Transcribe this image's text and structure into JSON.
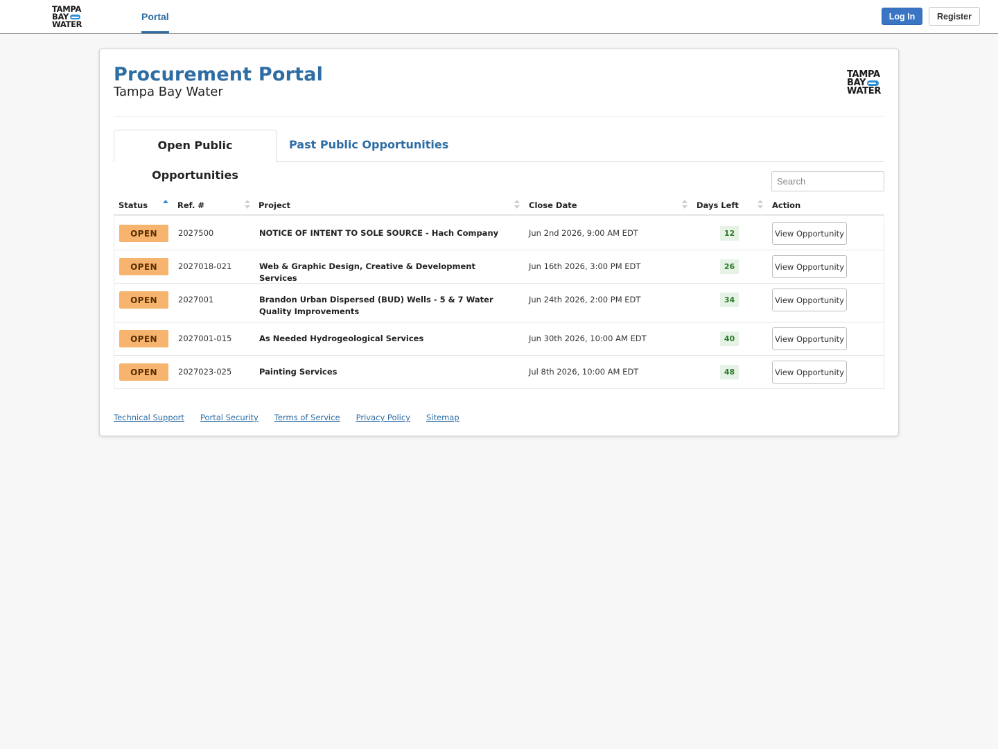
{
  "brand": {
    "logo_line1": "TAMPA",
    "logo_line2": "BAY",
    "logo_line3": "WATER"
  },
  "nav": {
    "portal": "Portal",
    "login": "Log In",
    "register": "Register"
  },
  "header": {
    "title": "Procurement Portal",
    "subtitle": "Tampa Bay Water"
  },
  "tabs": [
    {
      "label": "Open Public Opportunities",
      "active": true
    },
    {
      "label": "Past Public Opportunities",
      "active": false
    }
  ],
  "search": {
    "placeholder": "Search",
    "value": ""
  },
  "table": {
    "columns": [
      "Status",
      "Ref. #",
      "Project",
      "Close Date",
      "Days Left",
      "Action"
    ],
    "rows": [
      {
        "status": "OPEN",
        "ref": "2027500",
        "project": "NOTICE OF INTENT TO SOLE SOURCE - Hach Company",
        "close": "Jun 2nd 2026, 9:00 AM EDT",
        "days": "12",
        "action": "View Opportunity"
      },
      {
        "status": "OPEN",
        "ref": "2027018-021",
        "project": "Web & Graphic Design, Creative & Development Services",
        "close": "Jun 16th 2026, 3:00 PM EDT",
        "days": "26",
        "action": "View Opportunity"
      },
      {
        "status": "OPEN",
        "ref": "2027001",
        "project": "Brandon Urban Dispersed (BUD) Wells - 5 & 7 Water Quality Improvements",
        "close": "Jun 24th 2026, 2:00 PM EDT",
        "days": "34",
        "action": "View Opportunity"
      },
      {
        "status": "OPEN",
        "ref": "2027001-015",
        "project": "As Needed Hydrogeological Services",
        "close": "Jun 30th 2026, 10:00 AM EDT",
        "days": "40",
        "action": "View Opportunity"
      },
      {
        "status": "OPEN",
        "ref": "2027023-025",
        "project": "Painting Services",
        "close": "Jul 8th 2026, 10:00 AM EDT",
        "days": "48",
        "action": "View Opportunity"
      }
    ]
  },
  "footer": {
    "links": [
      "Technical Support",
      "Portal Security",
      "Terms of Service",
      "Privacy Policy",
      "Sitemap"
    ]
  },
  "colors": {
    "accent": "#2e6da4",
    "status_open": "#f7b46e",
    "days_bg": "#e6f2e6"
  }
}
